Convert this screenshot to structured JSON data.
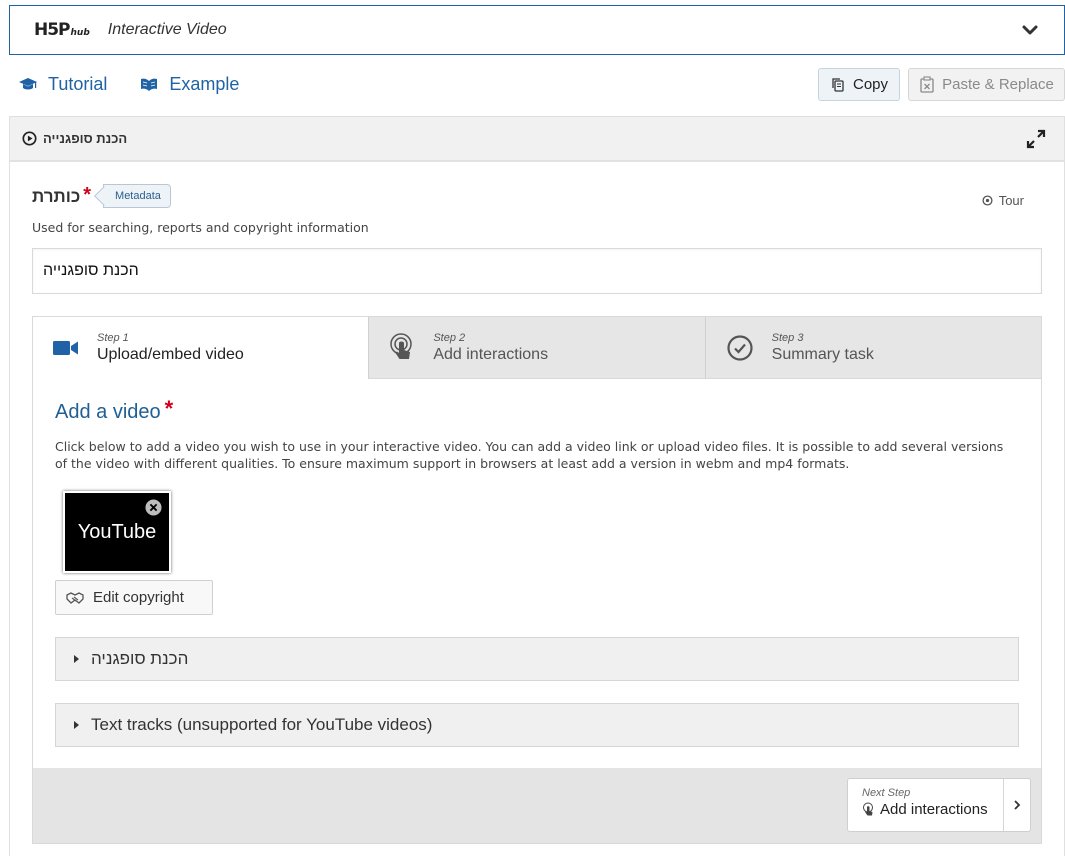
{
  "hub": {
    "logo_main": "H5P",
    "logo_sub": "hub",
    "title": "Interactive Video"
  },
  "links": {
    "tutorial": "Tutorial",
    "example": "Example"
  },
  "actions": {
    "copy": "Copy",
    "paste": "Paste & Replace"
  },
  "section": {
    "title": "הכנת סופגנייה"
  },
  "field": {
    "label": "כותרת",
    "required_mark": "*",
    "metadata": "Metadata",
    "tour": "Tour",
    "description": "Used for searching, reports and copyright information",
    "value": "הכנת סופגנייה"
  },
  "wizard": {
    "tabs": [
      {
        "step": "Step 1",
        "name": "Upload/embed video",
        "icon": "video-camera-icon"
      },
      {
        "step": "Step 2",
        "name": "Add interactions",
        "icon": "touch-hand-icon"
      },
      {
        "step": "Step 3",
        "name": "Summary task",
        "icon": "check-circle-icon"
      }
    ],
    "heading": "Add a video",
    "required_mark": "*",
    "description": "Click below to add a video you wish to use in your interactive video. You can add a video link or upload video files. It is possible to add several versions of the video with different qualities. To ensure maximum support in browsers at least add a version in webm and mp4 formats.",
    "thumbnail_label": "YouTube",
    "edit_copyright": "Edit copyright",
    "collapsibles": [
      "הכנת סופגניה",
      "Text tracks (unsupported for YouTube videos)"
    ],
    "next": {
      "step": "Next Step",
      "label": "Add interactions"
    }
  },
  "colors": {
    "primary": "#1f62a5",
    "required": "#d0021b"
  }
}
